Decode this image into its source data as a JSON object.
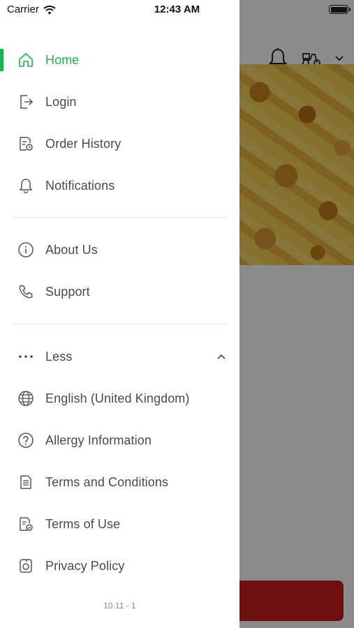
{
  "status_bar": {
    "carrier": "Carrier",
    "time": "12:43 AM"
  },
  "drawer": {
    "primary_items": [
      {
        "label": "Home",
        "icon": "home-icon",
        "active": true
      },
      {
        "label": "Login",
        "icon": "login-icon"
      },
      {
        "label": "Order History",
        "icon": "order-history-icon"
      },
      {
        "label": "Notifications",
        "icon": "bell-icon"
      }
    ],
    "secondary_items": [
      {
        "label": "About Us",
        "icon": "info-icon"
      },
      {
        "label": "Support",
        "icon": "phone-icon"
      }
    ],
    "more_toggle": {
      "label": "Less",
      "icon": "ellipsis-icon"
    },
    "extra_items": [
      {
        "label": "English (United Kingdom)",
        "icon": "globe-icon"
      },
      {
        "label": "Allergy Information",
        "icon": "question-circle-icon"
      },
      {
        "label": "Terms and Conditions",
        "icon": "document-icon"
      },
      {
        "label": "Terms of Use",
        "icon": "document-check-icon"
      },
      {
        "label": "Privacy Policy",
        "icon": "privacy-icon"
      }
    ],
    "version": "10.11 - 1"
  },
  "colors": {
    "accent": "#19b353",
    "text": "#4a4a4a",
    "cta_red": "#c91a1a"
  }
}
